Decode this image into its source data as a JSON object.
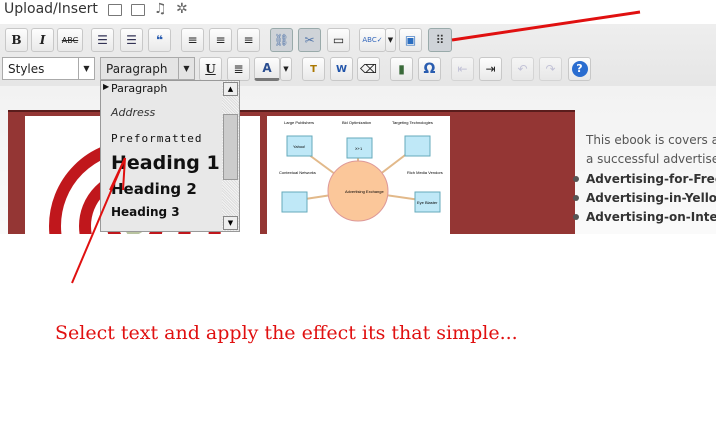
{
  "media_bar": {
    "label": "Upload/Insert",
    "icons": [
      "image-icon",
      "video-icon",
      "audio-icon",
      "media-icon"
    ]
  },
  "toolbar_row1": [
    {
      "name": "bold",
      "label": "B"
    },
    {
      "name": "italic",
      "label": "I"
    },
    {
      "name": "strikethrough",
      "label": "ABC"
    },
    {
      "name": "bullet-list",
      "label": "☰"
    },
    {
      "name": "numbered-list",
      "label": "☰"
    },
    {
      "name": "blockquote",
      "label": "❝"
    },
    {
      "name": "align-left",
      "label": "≡"
    },
    {
      "name": "align-center",
      "label": "≡"
    },
    {
      "name": "align-right",
      "label": "≡"
    },
    {
      "name": "insert-link",
      "label": "⛓"
    },
    {
      "name": "unlink",
      "label": "✂"
    },
    {
      "name": "insert-more",
      "label": "▭"
    },
    {
      "name": "spellcheck",
      "label": "ABC✓"
    },
    {
      "name": "fullscreen",
      "label": "▣"
    },
    {
      "name": "kitchen-sink",
      "label": "⠿"
    }
  ],
  "toolbar_row2": {
    "styles_select": "Styles",
    "format_select": "Paragraph",
    "buttons": [
      {
        "name": "underline",
        "label": "U"
      },
      {
        "name": "justify",
        "label": "≣"
      },
      {
        "name": "text-color",
        "label": "A"
      },
      {
        "name": "paste-text",
        "label": "T"
      },
      {
        "name": "paste-word",
        "label": "W"
      },
      {
        "name": "remove-format",
        "label": "⌫"
      },
      {
        "name": "insert-media",
        "label": "▮"
      },
      {
        "name": "special-char",
        "label": "Ω"
      },
      {
        "name": "outdent",
        "label": "⇤"
      },
      {
        "name": "indent",
        "label": "⇥"
      },
      {
        "name": "undo",
        "label": "↶"
      },
      {
        "name": "redo",
        "label": "↷"
      },
      {
        "name": "help",
        "label": "?"
      }
    ]
  },
  "format_dropdown": {
    "items": [
      "Paragraph",
      "Address",
      "Preformatted",
      "Heading 1",
      "Heading 2",
      "Heading 3"
    ],
    "selected": "Paragraph"
  },
  "content": {
    "diagram_labels": [
      "Large Publishers",
      "Bid Optimization",
      "Targeting Technologies",
      "Contextual Networks",
      "Rich Media Vendors",
      "Advertising Exchange",
      "Yahoo!",
      "X+1",
      "Eye Blaster"
    ],
    "description": [
      "This ebook is covers a",
      "a successful advertiser"
    ],
    "bullets": [
      "Advertising-for-Free",
      "Advertising-in-Yellow",
      "Advertising-on-Intern"
    ]
  },
  "caption": "Select text and apply the effect its that simple...",
  "colors": {
    "banner": "#943634",
    "annotation": "#e01010"
  }
}
